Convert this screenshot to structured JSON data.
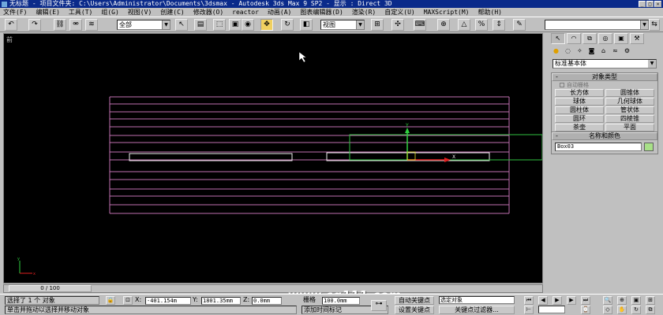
{
  "window": {
    "title": "无标题    - 项目文件夹: C:\\Users\\Administrator\\Documents\\3dsmax     - Autodesk 3ds Max 9 SP2     - 显示 : Direct 3D"
  },
  "menu": [
    "文件(F)",
    "编辑(E)",
    "工具(T)",
    "组(G)",
    "视图(V)",
    "创建(C)",
    "修改器(O)",
    "reactor",
    "动画(A)",
    "图表编辑器(D)",
    "渲染(R)",
    "自定义(U)",
    "MAXScript(M)",
    "帮助(H)"
  ],
  "toolbar": {
    "selection_filter": "全部",
    "ref_coord": "视图"
  },
  "viewport": {
    "label": "前"
  },
  "command_panel": {
    "category": "标准基本体",
    "object_type_title": "对象类型",
    "autogrid_label": "自动栅格",
    "object_buttons": [
      "长方体",
      "圆锥体",
      "球体",
      "几何球体",
      "圆柱体",
      "管状体",
      "圆环",
      "四棱锥",
      "茶壶",
      "平面"
    ],
    "name_color_title": "名称和颜色",
    "object_name": "Box03",
    "object_color": "#a8e088"
  },
  "timeline": {
    "slider_label": "0 / 100"
  },
  "status": {
    "selection_count": "选择了 1 个 对象",
    "prompt": "单击并拖动以选择并移动对象",
    "x_label": "X:",
    "x_value": "-401.154m",
    "y_label": "Y:",
    "y_value": "1801.35mm",
    "z_label": "Z:",
    "z_value": "0.0mm",
    "grid_label": "栅格",
    "grid_value": "100.0mm",
    "add_time_tag": "添加时间标记",
    "auto_key": "自动关键点",
    "set_key": "设置关键点",
    "key_mode": "选定对象",
    "key_filters": "关键点过滤器..."
  },
  "watermark": "www.cg111.com"
}
